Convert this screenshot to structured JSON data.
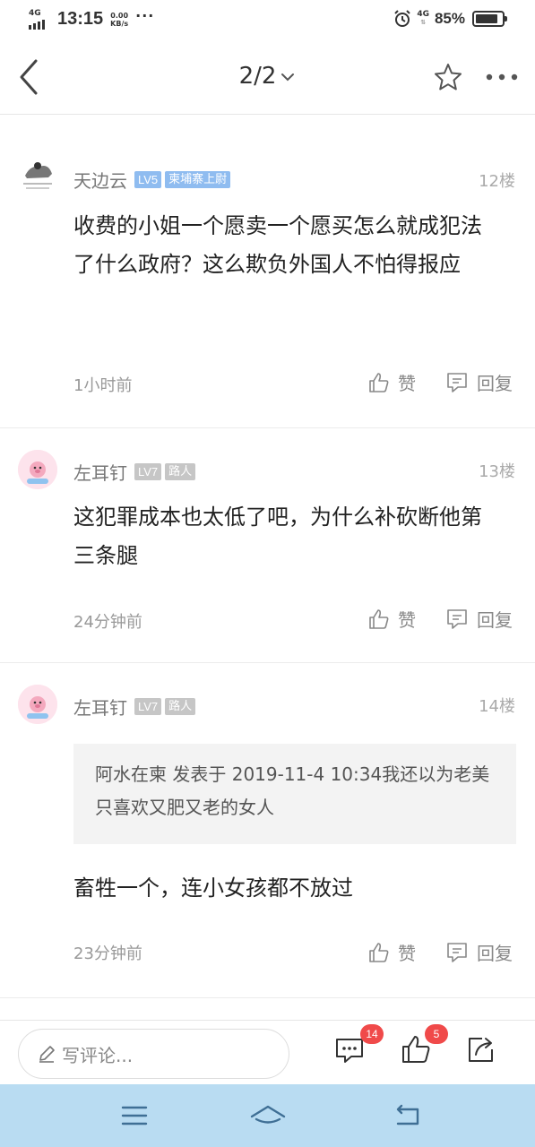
{
  "status_bar": {
    "network": "4G",
    "time": "13:15",
    "speed_value": "0.00",
    "speed_unit": "KB/s",
    "more_dots": "···",
    "network_right": "4G",
    "battery_percent": "85%",
    "battery_level": 0.85
  },
  "header": {
    "page_indicator": "2/2"
  },
  "comments": [
    {
      "username": "天边云",
      "level": "LV5",
      "title": "柬埔寨上尉",
      "floor": "12楼",
      "text": "收费的小姐一个愿卖一个愿买怎么就成犯法了什么政府？这么欺负外国人不怕得报应",
      "time": "1小时前",
      "like_label": "赞",
      "reply_label": "回复",
      "level_color": "#8fbcf0",
      "title_color": "#8fbcf0"
    },
    {
      "username": "左耳钉",
      "level": "LV7",
      "title": "路人",
      "floor": "13楼",
      "text": "这犯罪成本也太低了吧，为什么补砍断他第三条腿",
      "time": "24分钟前",
      "like_label": "赞",
      "reply_label": "回复",
      "level_color": "#c6c6c6",
      "title_color": "#c6c6c6"
    },
    {
      "username": "左耳钉",
      "level": "LV7",
      "title": "路人",
      "floor": "14楼",
      "quote": "阿水在柬 发表于 2019-11-4 10:34我还以为老美只喜欢又肥又老的女人",
      "text": "畜牲一个，连小女孩都不放过",
      "time": "23分钟前",
      "like_label": "赞",
      "reply_label": "回复",
      "level_color": "#c6c6c6",
      "title_color": "#c6c6c6"
    }
  ],
  "composer": {
    "placeholder": "写评论...",
    "comment_count": "14",
    "like_count": "5"
  },
  "colors": {
    "accent_badge": "#f04a4a",
    "system_nav": "#b9dcf2"
  }
}
